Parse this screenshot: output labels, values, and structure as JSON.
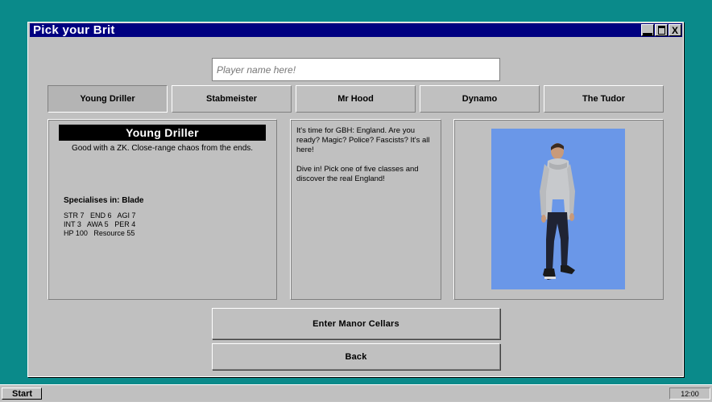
{
  "window": {
    "title": "Pick your Brit",
    "buttons": {
      "minimize": "",
      "maximize": "",
      "close": "X"
    }
  },
  "name_input": {
    "placeholder": "Player name here!",
    "value": ""
  },
  "class_tabs": [
    {
      "label": "Young Driller",
      "selected": true
    },
    {
      "label": "Stabmeister",
      "selected": false
    },
    {
      "label": "Mr Hood",
      "selected": false
    },
    {
      "label": "Dynamo",
      "selected": false
    },
    {
      "label": "The Tudor",
      "selected": false
    }
  ],
  "selected_class": {
    "name": "Young Driller",
    "tagline": "Good with a ZK. Close-range chaos from the ends.",
    "specialises": "Specialises in: Blade",
    "stats_lines": [
      "STR 7   END 6   AGI 7",
      "INT 3   AWA 5   PER 4",
      "HP 100   Resource 55"
    ]
  },
  "description": {
    "paragraphs": [
      "It's time for GBH: England. Are you ready? Magic? Police? Fascists? It's all here!",
      "Dive in! Pick one of five classes and discover the real England!"
    ]
  },
  "portrait": {
    "background_color": "#6a97e8"
  },
  "actions": {
    "enter_label": "Enter Manor Cellars",
    "back_label": "Back"
  },
  "taskbar": {
    "start_label": "Start",
    "clock": "12:00"
  },
  "colors": {
    "desktop": "#008080",
    "titlebar": "#000080",
    "window": "#c0c0c0"
  }
}
